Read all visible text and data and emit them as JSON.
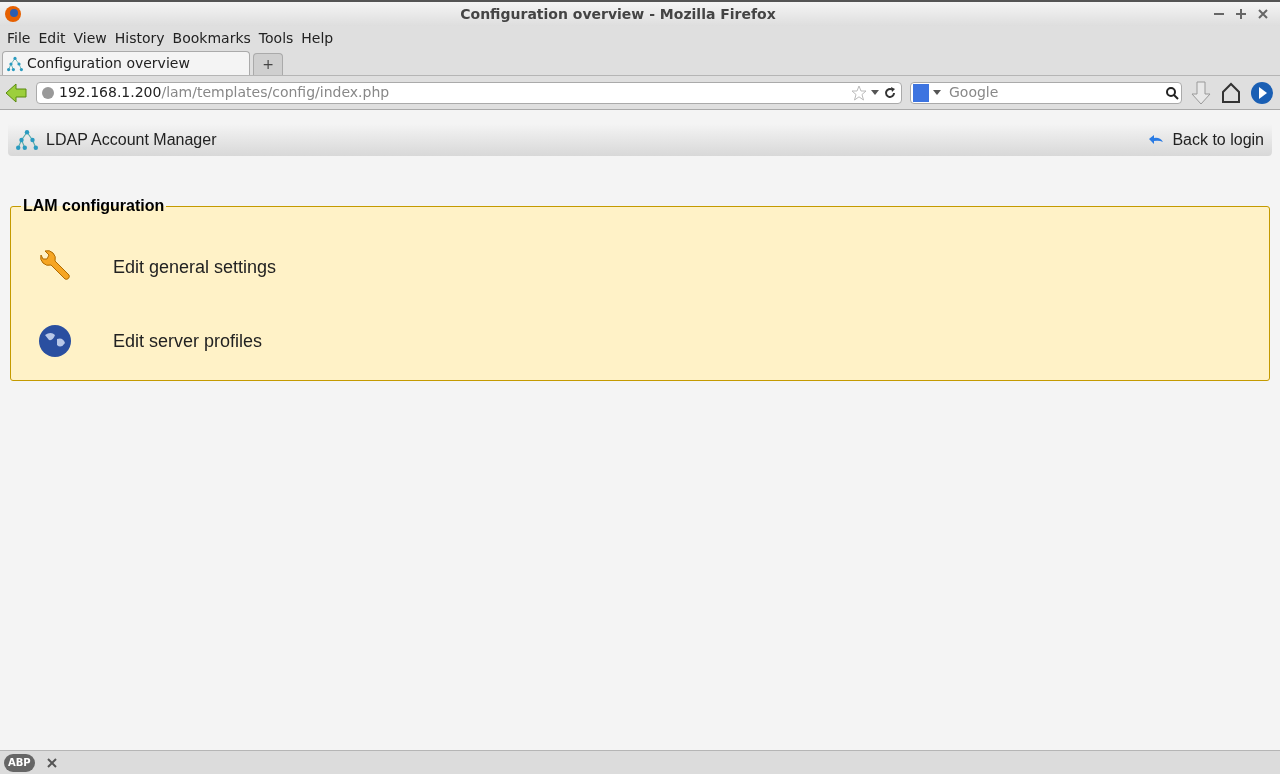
{
  "window": {
    "title": "Configuration overview - Mozilla Firefox"
  },
  "menu": [
    "File",
    "Edit",
    "View",
    "History",
    "Bookmarks",
    "Tools",
    "Help"
  ],
  "tabs": [
    {
      "label": "Configuration overview",
      "selected": true
    }
  ],
  "new_tab": "+",
  "address": {
    "host": "192.168.1.200",
    "path": "/lam/templates/config/index.php"
  },
  "search": {
    "placeholder": "Google"
  },
  "header": {
    "title": "LDAP Account Manager",
    "link": "Back to login"
  },
  "section": {
    "legend": "LAM configuration",
    "items": [
      {
        "kind": "settings",
        "label": "Edit general settings"
      },
      {
        "kind": "profiles",
        "label": "Edit server profiles"
      }
    ]
  },
  "status_bar": {
    "addon": "ABP"
  }
}
